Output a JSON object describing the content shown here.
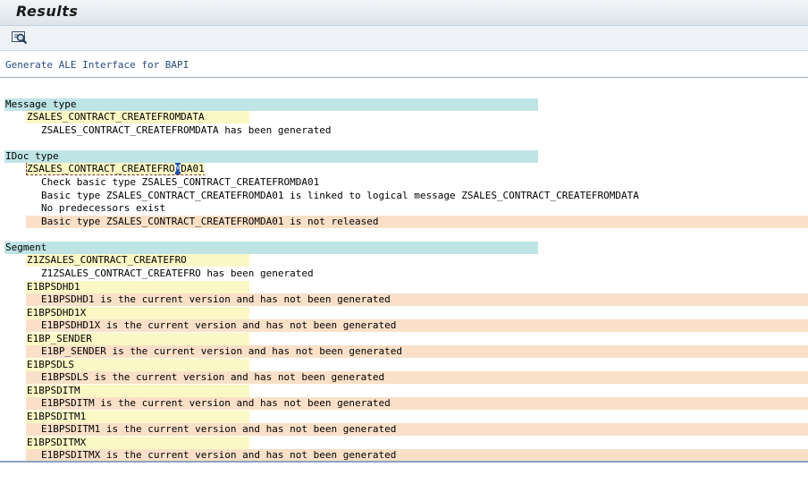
{
  "window": {
    "title": "Results"
  },
  "toolbar": {
    "detail_icon": "magnifier-icon"
  },
  "header": {
    "text": "Generate ALE Interface for BAPI"
  },
  "sections": {
    "message_type": {
      "label": "Message type",
      "object": "ZSALES_CONTRACT_CREATEFROMDATA",
      "messages": [
        "ZSALES_CONTRACT_CREATEFROMDATA has been generated"
      ]
    },
    "idoc_type": {
      "label": "IDoc type",
      "object_before": "ZSALES_CONTRACT_CREATEFRO",
      "object_cursor": "M",
      "object_after": "DA01",
      "messages": [
        "Check basic type ZSALES_CONTRACT_CREATEFROMDA01",
        "Basic type ZSALES_CONTRACT_CREATEFROMDA01 is linked to logical message ZSALES_CONTRACT_CREATEFROMDATA",
        "No predecessors exist",
        "Basic type ZSALES_CONTRACT_CREATEFROMDA01 is not released"
      ]
    },
    "segment": {
      "label": "Segment",
      "items": [
        {
          "object": "Z1ZSALES_CONTRACT_CREATEFRO",
          "message": "Z1ZSALES_CONTRACT_CREATEFRO has been generated",
          "status": "ok"
        },
        {
          "object": "E1BPSDHD1",
          "message": "E1BPSDHD1 is the current version and has not been generated",
          "status": "warn"
        },
        {
          "object": "E1BPSDHD1X",
          "message": "E1BPSDHD1X is the current version and has not been generated",
          "status": "warn"
        },
        {
          "object": "E1BP_SENDER",
          "message": "E1BP_SENDER is the current version and has not been generated",
          "status": "warn"
        },
        {
          "object": "E1BPSDLS",
          "message": "E1BPSDLS is the current version and has not been generated",
          "status": "warn"
        },
        {
          "object": "E1BPSDITM",
          "message": "E1BPSDITM is the current version and has not been generated",
          "status": "warn"
        },
        {
          "object": "E1BPSDITM1",
          "message": "E1BPSDITM1 is the current version and has not been generated",
          "status": "warn"
        },
        {
          "object": "E1BPSDITMX",
          "message": "E1BPSDITMX is the current version and has not been generated",
          "status": "warn"
        }
      ]
    }
  }
}
